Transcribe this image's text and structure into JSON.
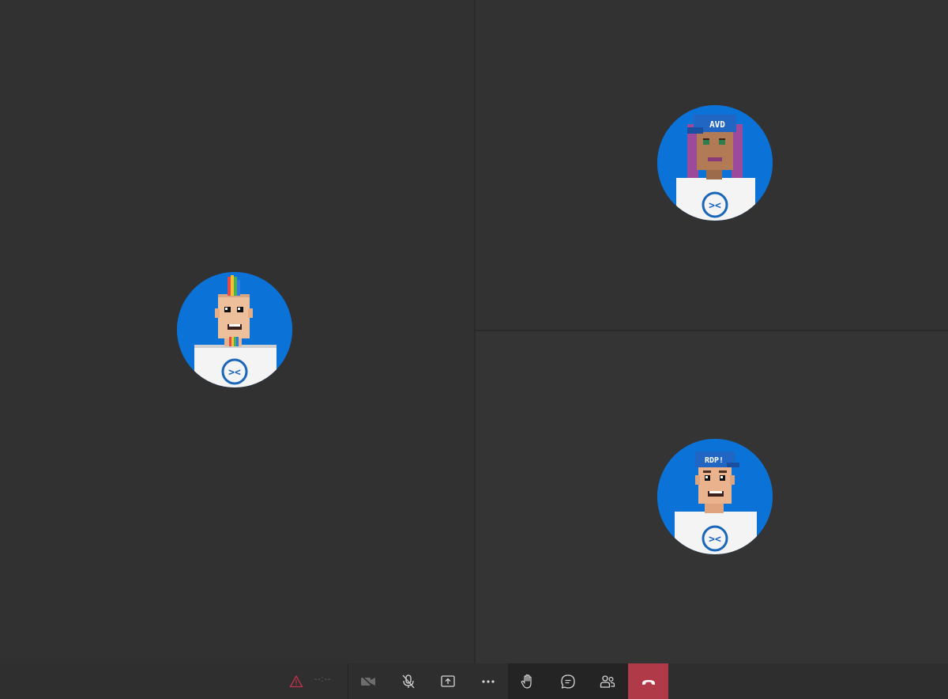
{
  "participants": [
    {
      "avatar_caption": ""
    },
    {
      "avatar_caption": "AVD"
    },
    {
      "avatar_caption": "RDP!"
    }
  ],
  "call_bar": {
    "timer": "--:--",
    "icons": {
      "warning": "warning-icon",
      "camera": "camera-off-icon",
      "mic": "mic-off-icon",
      "share": "share-screen-icon",
      "more": "more-icon",
      "hand": "raise-hand-icon",
      "chat": "chat-icon",
      "people": "participants-icon",
      "hangup": "hangup-icon"
    }
  },
  "colors": {
    "avatar_bg": "#0b72d8",
    "hangup_bg": "#b03a48",
    "warning": "#c4314b"
  }
}
